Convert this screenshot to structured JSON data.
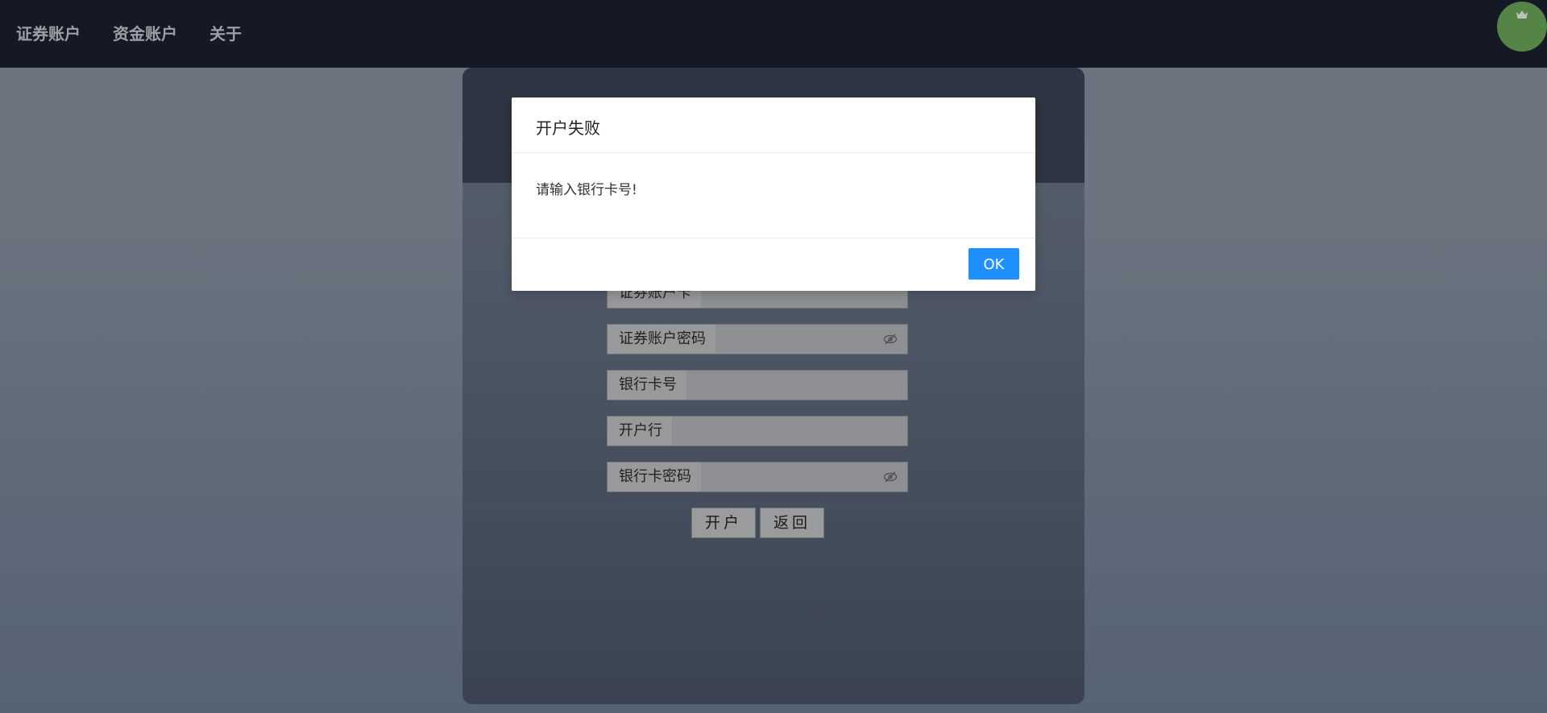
{
  "nav": {
    "items": [
      {
        "label": "证券账户"
      },
      {
        "label": "资金账户"
      },
      {
        "label": "关于"
      }
    ]
  },
  "form": {
    "fields": [
      {
        "label": "证券账户卡",
        "has_eye_toggle": false
      },
      {
        "label": "证券账户密码",
        "has_eye_toggle": true
      },
      {
        "label": "银行卡号",
        "has_eye_toggle": false
      },
      {
        "label": "开户行",
        "has_eye_toggle": false
      },
      {
        "label": "银行卡密码",
        "has_eye_toggle": true
      }
    ],
    "open_button_label": "开户",
    "back_button_label": "返回"
  },
  "modal": {
    "title": "开户失败",
    "message": "请输入银行卡号!",
    "ok_label": "OK",
    "ok_color": "#1e90ff"
  },
  "colors": {
    "topbar": "#1c2130",
    "avatar": "#6ea95a"
  },
  "icons": {
    "avatar": "avatar-crown-icon",
    "password_toggle": "eye-slash-icon"
  }
}
